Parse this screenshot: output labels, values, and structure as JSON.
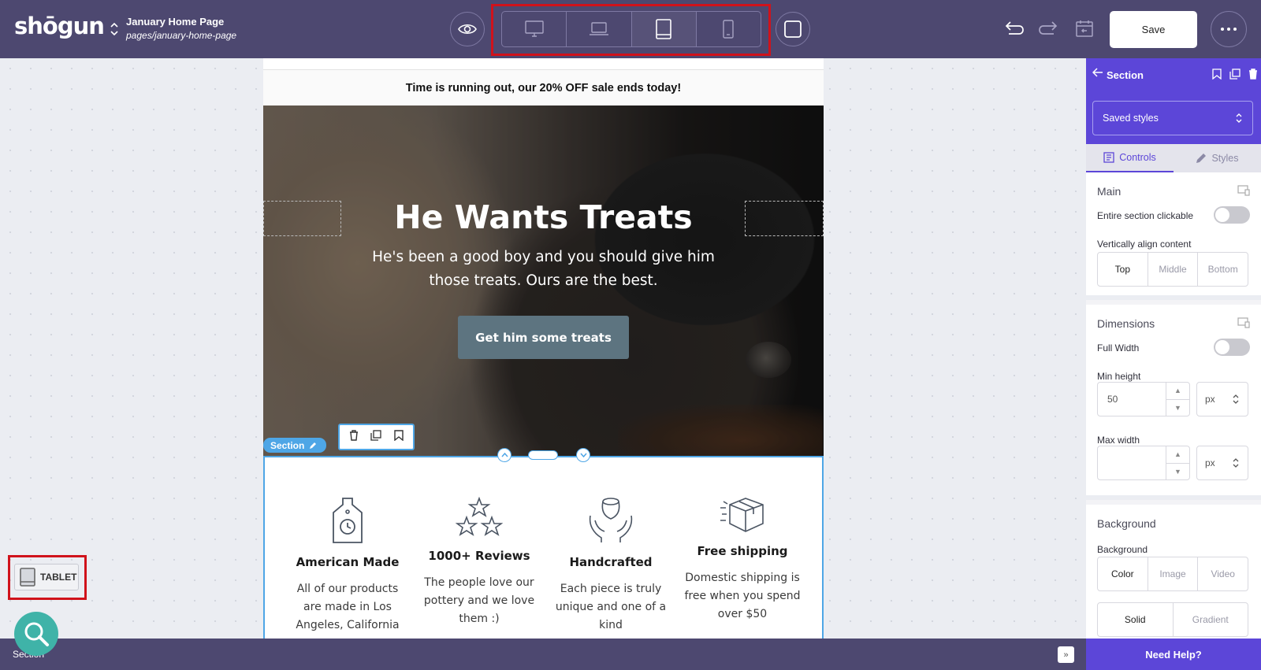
{
  "topbar": {
    "logo": "shōgun",
    "page_title": "January Home Page",
    "page_path": "pages/january-home-page",
    "save_label": "Save",
    "device_buttons": [
      "desktop",
      "laptop",
      "tablet",
      "mobile"
    ],
    "active_device": "tablet"
  },
  "page": {
    "announcement": "Time is running out, our 20% OFF sale ends today!",
    "hero": {
      "title": "He Wants Treats",
      "subtitle": "He's been a good boy and you should give him those treats. Ours are the best.",
      "cta": "Get him some treats"
    },
    "features": [
      {
        "icon": "bottle-clock-icon",
        "title": "American Made",
        "text": "All of our products are made in Los Angeles, California"
      },
      {
        "icon": "stars-icon",
        "title": "1000+ Reviews",
        "text": "The people love our pottery and we love them :)"
      },
      {
        "icon": "hands-vase-icon",
        "title": "Handcrafted",
        "text": "Each piece is truly unique and one of a kind"
      },
      {
        "icon": "package-icon",
        "title": "Free shipping",
        "text": "Domestic shipping is free when you spend over $50"
      }
    ]
  },
  "editor": {
    "section_label": "Section",
    "device_badge": "TABLET",
    "bottom_label": "Section"
  },
  "panel": {
    "title": "Section",
    "saved_styles": "Saved styles",
    "tabs": [
      "Controls",
      "Styles"
    ],
    "main": {
      "title": "Main",
      "entire_clickable": "Entire section clickable",
      "valign_label": "Vertically align content",
      "valign_options": [
        "Top",
        "Middle",
        "Bottom"
      ],
      "valign_selected": "Top"
    },
    "dimensions": {
      "title": "Dimensions",
      "full_width": "Full Width",
      "min_height_label": "Min height",
      "min_height_value": "50",
      "min_height_unit": "px",
      "max_width_label": "Max width",
      "max_width_value": "",
      "max_width_unit": "px"
    },
    "background": {
      "title": "Background",
      "label": "Background",
      "type_options": [
        "Color",
        "Image",
        "Video"
      ],
      "type_selected": "Color",
      "fill_options": [
        "Solid",
        "Gradient"
      ],
      "fill_selected": "Solid"
    },
    "need_help": "Need Help?"
  },
  "colors": {
    "topbar": "#4d4870",
    "accent": "#5c46d8",
    "selection": "#4ea6e6",
    "highlight": "#d0121b",
    "cta": "#5d7480"
  }
}
